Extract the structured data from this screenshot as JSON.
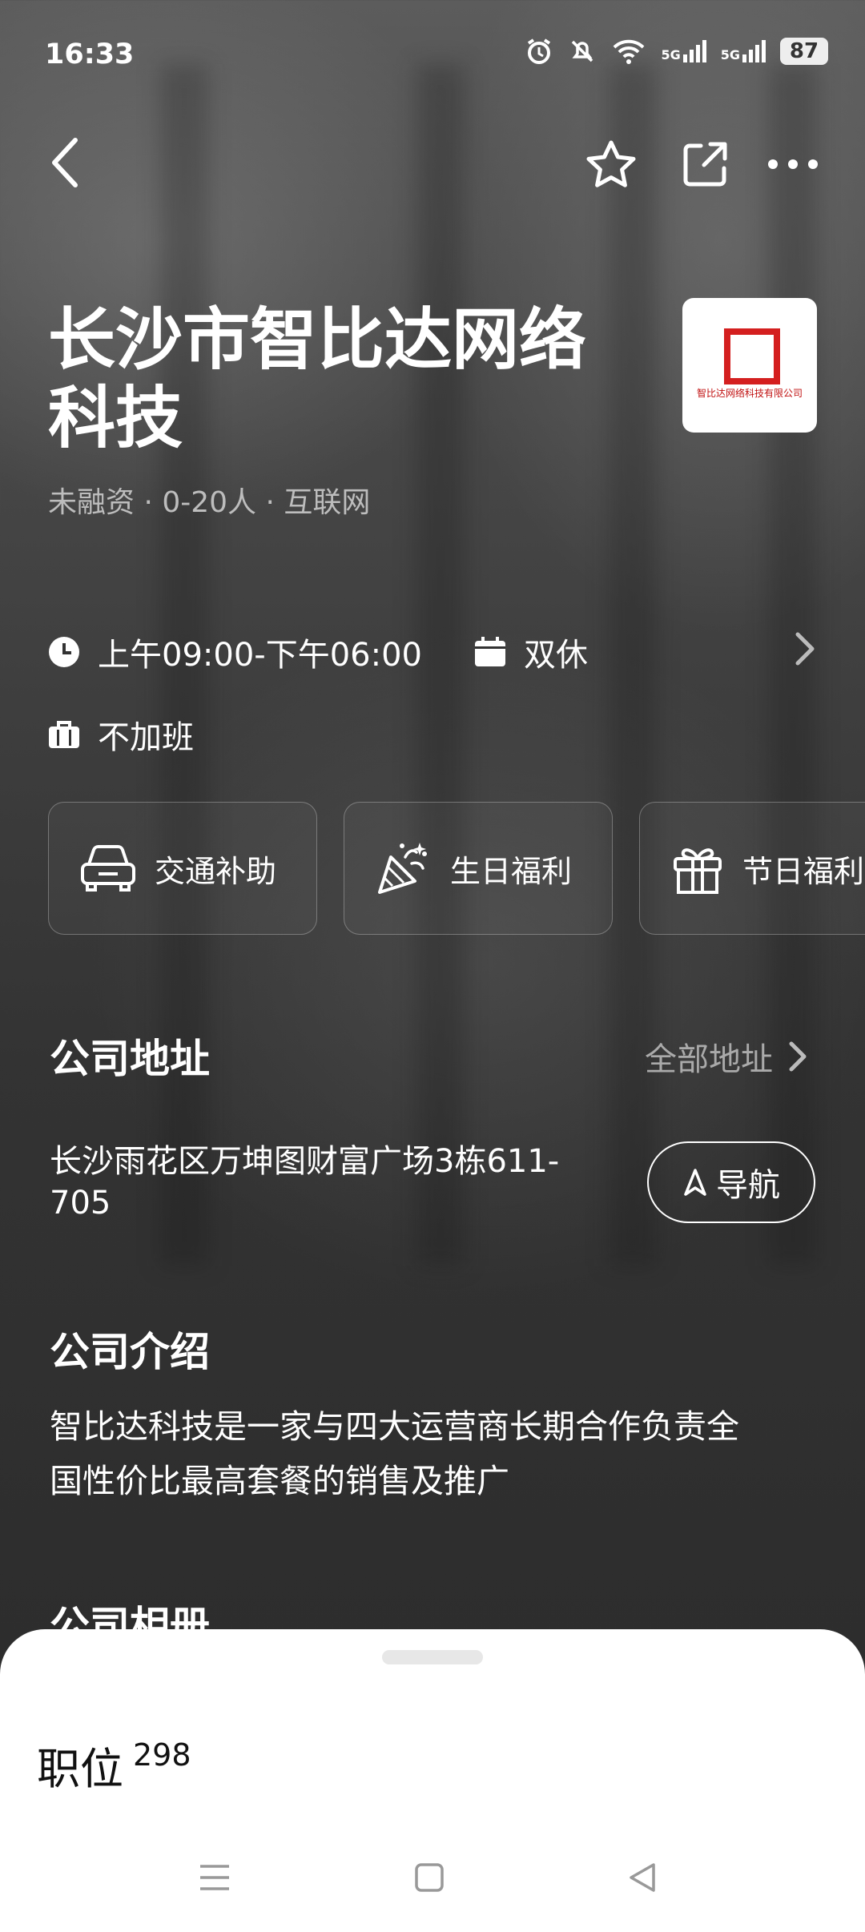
{
  "status_bar": {
    "time": "16:33",
    "network_1": "5G",
    "network_2": "5G",
    "battery": "87"
  },
  "company": {
    "name": "长沙市智比达网络科技",
    "meta": "未融资 · 0-20人 · 互联网",
    "logo_text": "智比达网络科技有限公司"
  },
  "work": {
    "hours": "上午09:00-下午06:00",
    "rest": "双休",
    "overtime": "不加班"
  },
  "benefits": [
    {
      "label": "交通补助",
      "icon": "car-icon"
    },
    {
      "label": "生日福利",
      "icon": "party-popper-icon"
    },
    {
      "label": "节日福利",
      "icon": "gift-icon"
    }
  ],
  "address_section": {
    "title": "公司地址",
    "all_link": "全部地址",
    "address": "长沙雨花区万坤图财富广场3栋611-705",
    "nav_button": "导航"
  },
  "intro_section": {
    "title": "公司介绍",
    "text": "智比达科技是一家与四大运营商长期合作负责全国性价比最高套餐的销售及推广"
  },
  "album_section": {
    "title": "公司相册"
  },
  "bottom_sheet": {
    "label": "职位",
    "count": "298"
  }
}
